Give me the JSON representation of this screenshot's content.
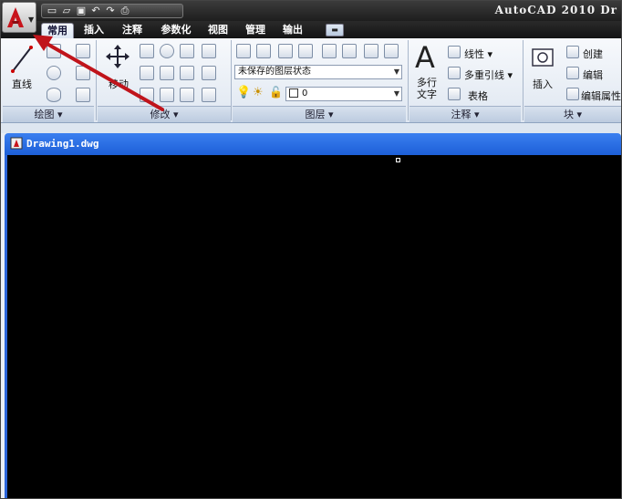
{
  "window": {
    "title": "AutoCAD 2010  Dr"
  },
  "app_button": {
    "icon": "autocad-logo-icon"
  },
  "quick_access": {
    "icons": [
      "new-icon",
      "open-icon",
      "save-icon",
      "undo-icon",
      "redo-icon",
      "print-icon"
    ]
  },
  "tabs": [
    {
      "label": "常用",
      "active": true
    },
    {
      "label": "插入"
    },
    {
      "label": "注释"
    },
    {
      "label": "参数化"
    },
    {
      "label": "视图"
    },
    {
      "label": "管理"
    },
    {
      "label": "输出"
    }
  ],
  "draw_panel": {
    "line_label": "直线",
    "title": "绘图"
  },
  "modify_panel": {
    "move_label": "移动",
    "title": "修改"
  },
  "layers_panel": {
    "layer_state": "未保存的图层状态",
    "current_layer": "0",
    "title": "图层"
  },
  "annotation_panel": {
    "mtext_label1": "多行",
    "mtext_label2": "文字",
    "linear_label": "线性",
    "multileader_label": "多重引线",
    "table_label": "表格",
    "title": "注释"
  },
  "block_panel": {
    "insert_label": "插入",
    "create_label": "创建",
    "edit_label": "编辑",
    "edit_attr_label": "编辑属性",
    "title": "块"
  },
  "document": {
    "tab_title": "Drawing1.dwg"
  },
  "colors": {
    "accent_arrow": "#c0141b",
    "doc_header": "#1d5fd8",
    "canvas": "#000000"
  }
}
